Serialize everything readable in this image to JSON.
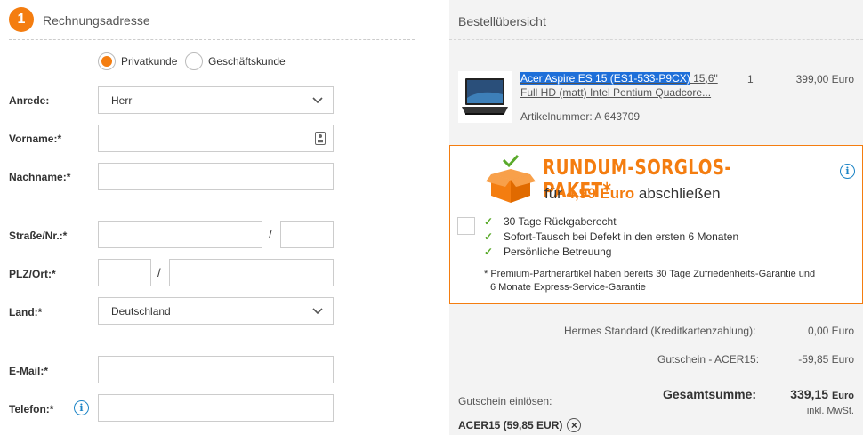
{
  "billing": {
    "step": "1",
    "title": "Rechnungsadresse",
    "customer_types": [
      "Privatkunde",
      "Geschäftskunde"
    ],
    "selected_customer_type": "Privatkunde",
    "labels": {
      "salutation": "Anrede:",
      "first_name": "Vorname:*",
      "last_name": "Nachname:*",
      "street": "Straße/Nr.:*",
      "zip_city": "PLZ/Ort:*",
      "country": "Land:*",
      "email": "E-Mail:*",
      "phone": "Telefon:*"
    },
    "values": {
      "salutation": "Herr",
      "country": "Deutschland"
    },
    "separator": "/"
  },
  "order": {
    "title": "Bestellübersicht",
    "product": {
      "name_highlight": "Acer Aspire ES 15 (ES1-533-P9CX)",
      "name_rest": " 15,6\" Full HD (matt) Intel Pentium Quadcore...",
      "quantity": "1",
      "price": "399,00 Euro",
      "article_number": "Artikelnummer: A 643709"
    },
    "promo": {
      "title": "RUNDUM-SORGLOS-PAKET*",
      "sub_prefix": "für",
      "sub_price": "4,99 Euro",
      "sub_suffix": "abschließen",
      "benefits": [
        "30 Tage Rückgaberecht",
        "Sofort-Tausch bei Defekt in den ersten 6 Monaten",
        "Persönliche Betreuung"
      ],
      "note_line1": "* Premium-Partnerartikel haben bereits 30 Tage Zufriedenheits-Garantie und",
      "note_line2": "6 Monate Express-Service-Garantie",
      "accent_color": "#f47d10"
    },
    "shipping_label": "Hermes Standard (Kreditkartenzahlung):",
    "shipping_value": "0,00 Euro",
    "voucher_label": "Gutschein - ACER15:",
    "voucher_value": "-59,85 Euro",
    "total_label": "Gesamtsumme:",
    "total_value": "339,15",
    "total_currency": "Euro",
    "vat_note": "inkl. MwSt.",
    "coupon_label": "Gutschein einlösen:",
    "coupon_code": "ACER15 (59,85 EUR)"
  }
}
